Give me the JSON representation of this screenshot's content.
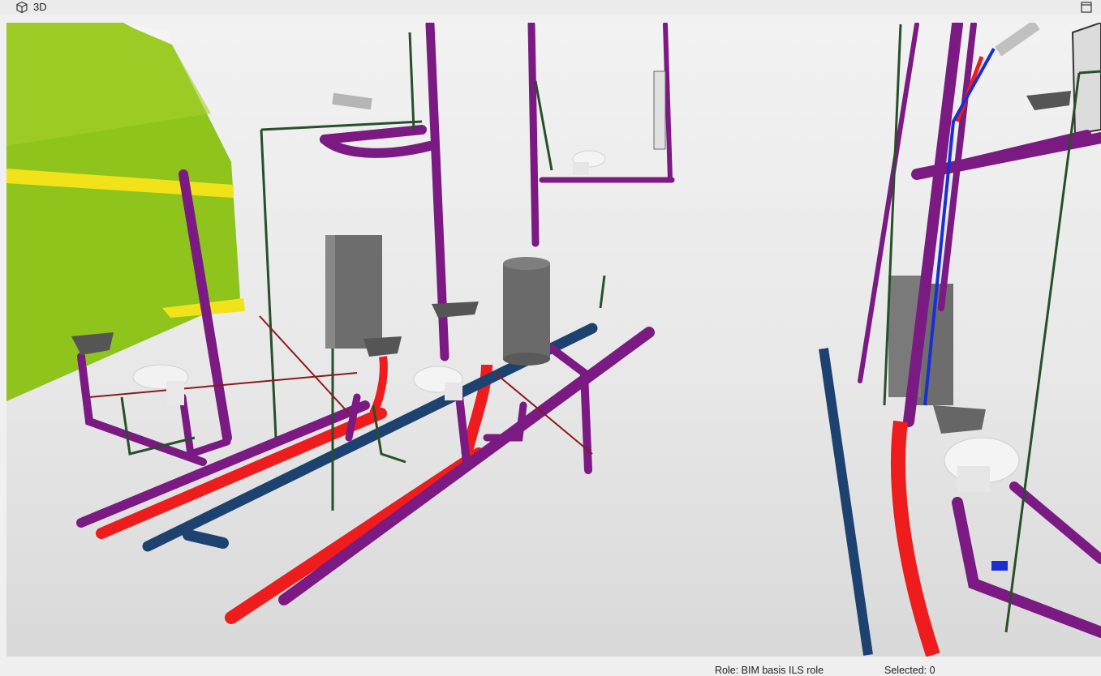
{
  "window": {
    "title": "3D",
    "title_icon": "cube-icon",
    "maximize_icon": "maximize-icon"
  },
  "viewport": {
    "scene": "3d-bim-plumbing-model",
    "colors": {
      "waste_pipe": "#7a1a82",
      "hot_water": "#ee1c1c",
      "cold_water": "#1e4270",
      "supply_blue": "#1a2fd0",
      "green_line": "#27502a",
      "wall": "#92c81e",
      "beam": "#f2e21a",
      "boiler": "#6d6d6d"
    }
  },
  "status": {
    "role": "Role: BIM basis ILS role",
    "selected": "Selected: 0"
  }
}
